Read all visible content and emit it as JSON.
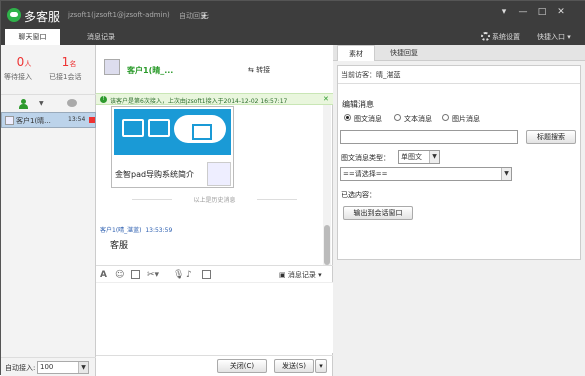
{
  "app": {
    "name": "多客服",
    "account": "jzsoft1(jzsoft1@jzsoft-admin)",
    "auto_reply_label": "自动回复:",
    "auto_reply_value": "无",
    "window_controls": [
      "▾",
      "—",
      "□",
      "✕"
    ]
  },
  "tabs": {
    "items": [
      "聊天窗口",
      "消息记录"
    ],
    "active": 0,
    "settings_label": "系统设置",
    "shortcut_label": "快捷入口"
  },
  "stats": {
    "waiting_num": "0",
    "waiting_unit": "人",
    "waiting_label": "等待接入",
    "accepted_num": "1",
    "accepted_unit": "名",
    "accepted_label": "已接1会话"
  },
  "visitors": [
    {
      "name": "客户1(晴...",
      "time": "13:54"
    }
  ],
  "auto_accept": {
    "label": "自动接入:",
    "value": "100"
  },
  "chat": {
    "customer_name": "客户1(晴_...",
    "transfer_label": "转接",
    "notice": "该客户是第6次接入，上次由jzsoft1接入于2014-12-02 16:57:17",
    "card_title": "金智pad导购系统简介",
    "history_sep": "以上是历史消息",
    "message_sender": "客户1(晴_湛蓝)",
    "message_time": "13:53:59",
    "message_text": "客服",
    "history_link": "消息记录",
    "close_btn": "关闭(C)",
    "send_btn": "发送(S)"
  },
  "right": {
    "tabs": [
      "素材",
      "快捷回复"
    ],
    "active": 0,
    "current_visitor": "当前访客：晴_湛蓝",
    "edit_label": "编辑消息",
    "radio_options": [
      "图文消息",
      "文本消息",
      "图片消息"
    ],
    "radio_selected": 0,
    "search_btn": "标题搜索",
    "type_label": "图文消息类型：",
    "type_value": "单图文",
    "please_select": "==请选择==",
    "selected_label": "已选内容：",
    "output_btn": "输出到会话窗口"
  }
}
